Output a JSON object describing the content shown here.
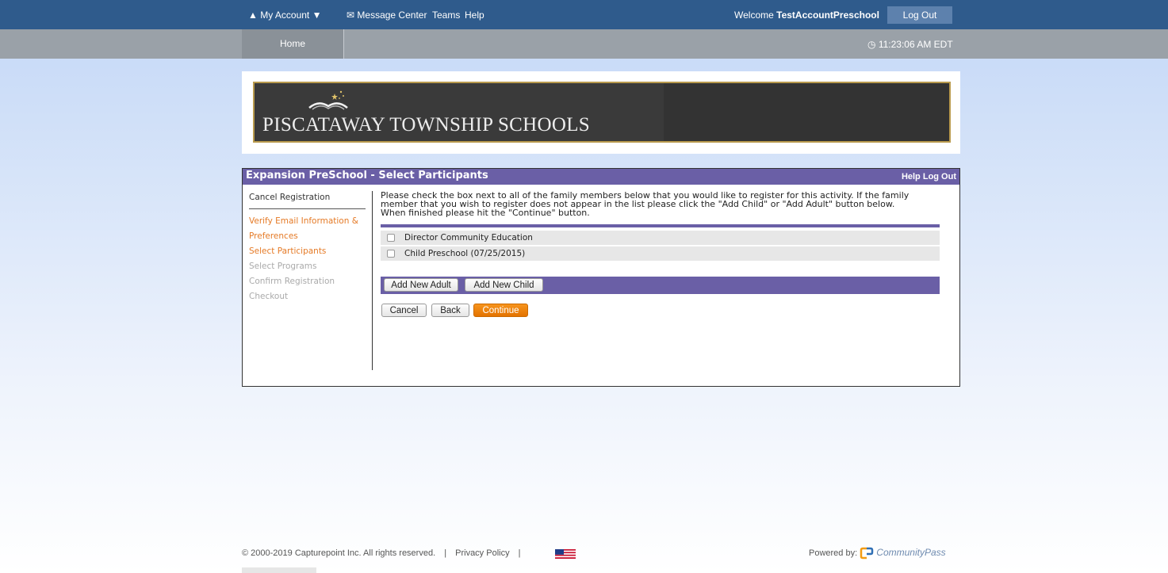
{
  "topbar": {
    "my_account": "My Account",
    "message_center": "Message Center",
    "teams": "Teams",
    "help": "Help",
    "welcome_prefix": "Welcome ",
    "username": "TestAccountPreschool",
    "logout": "Log Out"
  },
  "navbar": {
    "home": "Home",
    "time": "11:23:06 AM EDT"
  },
  "banner": {
    "school_name": "PISCATAWAY TOWNSHIP SCHOOLS"
  },
  "panel": {
    "title": "Expansion PreSchool - Select Participants",
    "help": "Help",
    "logout": "Log Out"
  },
  "sidebar": {
    "cancel_registration": "Cancel Registration",
    "steps": [
      {
        "label": "Verify Email Information &",
        "state": "active"
      },
      {
        "label": "Preferences",
        "state": "active"
      },
      {
        "label": "Select Participants",
        "state": "active"
      },
      {
        "label": "Select Programs",
        "state": "inactive"
      },
      {
        "label": "Confirm Registration",
        "state": "inactive"
      },
      {
        "label": "Checkout",
        "state": "inactive"
      }
    ]
  },
  "content": {
    "instructions_line1": "Please check the box next to all of the family members below that you would like to register for this activity. If the family",
    "instructions_line2": "member that you wish to register does not appear in the list please click the \"Add Child\" or \"Add Adult\" button below.",
    "instructions_line3": "When finished please hit the \"Continue\" button.",
    "members": [
      {
        "name": "Director Community Education",
        "checked": false
      },
      {
        "name": "Child Preschool (07/25/2015)",
        "checked": false
      }
    ],
    "add_adult": "Add New Adult",
    "add_child": "Add New Child",
    "cancel": "Cancel",
    "back": "Back",
    "continue": "Continue"
  },
  "footer": {
    "copyright": "© 2000-2019 Capturepoint Inc. All rights reserved.",
    "separator": "|",
    "privacy": "Privacy Policy",
    "powered_by": "Powered by:",
    "brand": "CommunityPass"
  },
  "colors": {
    "topbar": "#2f5b8c",
    "navbar": "#9aa1a8",
    "panel_header": "#6a5fa6",
    "accent_orange": "#e57a26",
    "banner_border": "#b99a4d"
  }
}
